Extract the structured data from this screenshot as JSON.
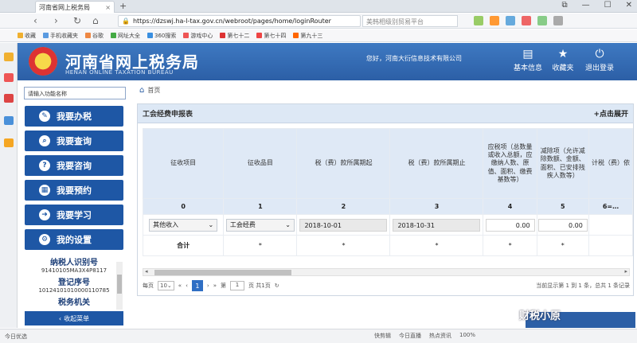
{
  "browser": {
    "tab_title": "河南省网上税务局",
    "url": "https://dzswj.ha-l-tax.gov.cn/webroot/pages/home/loginRouter",
    "search_text": "美韩相级别贸易平台",
    "bookmarks": [
      "收藏",
      "手机收藏夹",
      "谷歌",
      "网址大全",
      "360搜索",
      "游戏中心",
      "第七十二",
      "第七十四",
      "第九十三"
    ],
    "status_left": "今日优选",
    "status_right": [
      "快剪辑",
      "今日直播",
      "热点资讯"
    ],
    "zoom": "100%"
  },
  "header": {
    "title": "河南省网上税务局",
    "subtitle": "HENAN ONLINE TAXATION BUREAU",
    "welcome": "您好，河南大衍信息技术有限公司",
    "buttons": [
      {
        "icon": "id-card-icon",
        "label": "基本信息"
      },
      {
        "icon": "star-icon",
        "label": "收藏夹"
      },
      {
        "icon": "power-icon",
        "label": "退出登录"
      }
    ]
  },
  "sidebar": {
    "search_placeholder": "请输入功能名称",
    "menu": [
      {
        "icon": "✎",
        "label": "我要办税"
      },
      {
        "icon": "⌕",
        "label": "我要查询"
      },
      {
        "icon": "?",
        "label": "我要咨询"
      },
      {
        "icon": "▦",
        "label": "我要预约"
      },
      {
        "icon": "➜",
        "label": "我要学习"
      },
      {
        "icon": "⚙",
        "label": "我的设置"
      }
    ],
    "taxpayer_id_label": "纳税人识别号",
    "taxpayer_id": "91410105MA3X4P8117",
    "reg_no_label": "登记序号",
    "reg_no": "10124101010000110785",
    "tax_office_label": "税务机关",
    "collapse_label": "收起菜单"
  },
  "breadcrumb": {
    "home": "首页"
  },
  "panel": {
    "title": "工会经费申报表",
    "expand": "+点击展开",
    "headers": [
      "征收项目",
      "征收品目",
      "税（费）款所属期起",
      "税（费）款所属期止",
      "应税项（总数量或收入总额，应缴纳人数、原值、面积、缴费基数等）",
      "减除项（允许减除数额、金额、面积、已安排残疾人数等）",
      "计税（费）依"
    ],
    "indexes": [
      "0",
      "1",
      "2",
      "3",
      "4",
      "5",
      "6=…"
    ],
    "row": {
      "project": "其他收入",
      "item": "工会经费",
      "start": "2018-10-01",
      "end": "2018-10-31",
      "v4": "0.00",
      "v5": "0.00"
    },
    "total_row": {
      "label": "合计",
      "cells": [
        "*",
        "*",
        "*",
        "*",
        "*"
      ]
    },
    "pager": {
      "per_page_label": "每页",
      "per_page": "10",
      "page_label": "第",
      "page": "1",
      "of_label": "页 共1页",
      "current": "1",
      "info": "当前显示第 1 到 1 条，总共 1 条记录"
    }
  },
  "watermark": "财税小原"
}
